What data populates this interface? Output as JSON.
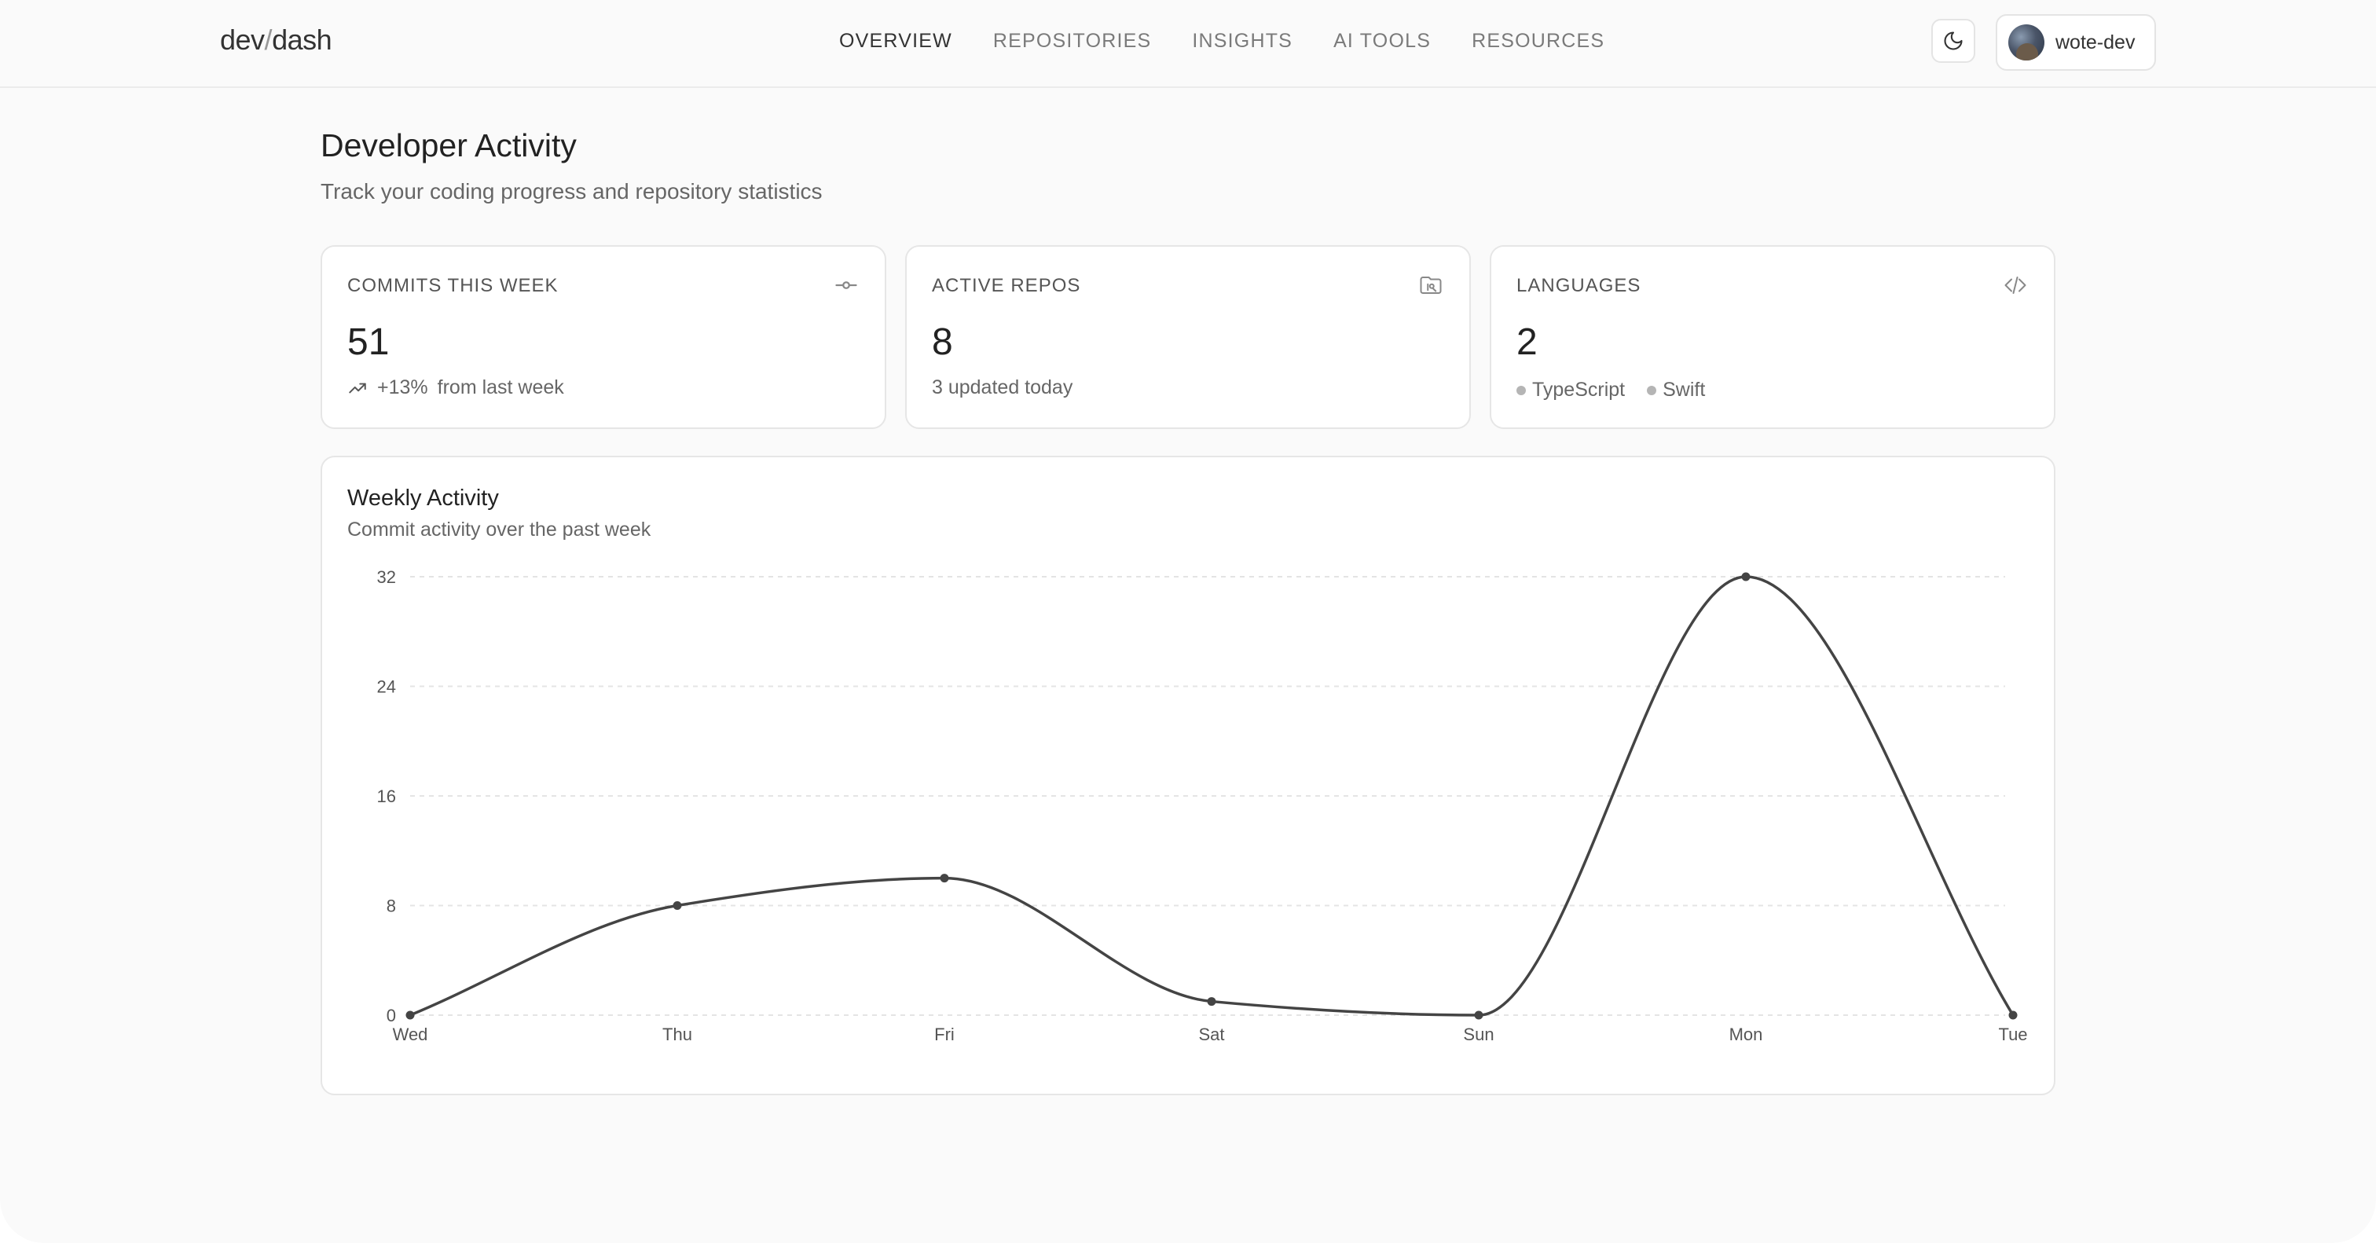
{
  "app": {
    "logo_left": "dev",
    "logo_slash": "/",
    "logo_right": "dash"
  },
  "nav": {
    "items": [
      {
        "label": "OVERVIEW",
        "active": true
      },
      {
        "label": "REPOSITORIES",
        "active": false
      },
      {
        "label": "INSIGHTS",
        "active": false
      },
      {
        "label": "AI TOOLS",
        "active": false
      },
      {
        "label": "RESOURCES",
        "active": false
      }
    ]
  },
  "header_actions": {
    "theme_icon": "moon-icon",
    "username": "wote-dev"
  },
  "page": {
    "title": "Developer Activity",
    "subtitle": "Track your coding progress and repository statistics"
  },
  "stats": {
    "commits": {
      "label": "COMMITS THIS WEEK",
      "icon": "commit-icon",
      "value": "51",
      "trend_icon": "trending-up-icon",
      "change": "+13%",
      "change_text": "from last week"
    },
    "repos": {
      "label": "ACTIVE REPOS",
      "icon": "folder-git-icon",
      "value": "8",
      "sub": "3 updated today"
    },
    "languages": {
      "label": "LANGUAGES",
      "icon": "code-icon",
      "value": "2",
      "items": [
        "TypeScript",
        "Swift"
      ]
    }
  },
  "activity_chart": {
    "title": "Weekly Activity",
    "subtitle": "Commit activity over the past week"
  },
  "chart_data": {
    "type": "line",
    "title": "Weekly Activity",
    "subtitle": "Commit activity over the past week",
    "categories": [
      "Wed",
      "Thu",
      "Fri",
      "Sat",
      "Sun",
      "Mon",
      "Tue"
    ],
    "series": [
      {
        "values": [
          0,
          8,
          10,
          1,
          0,
          32,
          0
        ]
      }
    ],
    "yticks": [
      0,
      8,
      16,
      24,
      32
    ],
    "ylim": [
      0,
      32
    ],
    "grid": true,
    "line_color": "#444444",
    "grid_color": "#e4e4e4"
  }
}
